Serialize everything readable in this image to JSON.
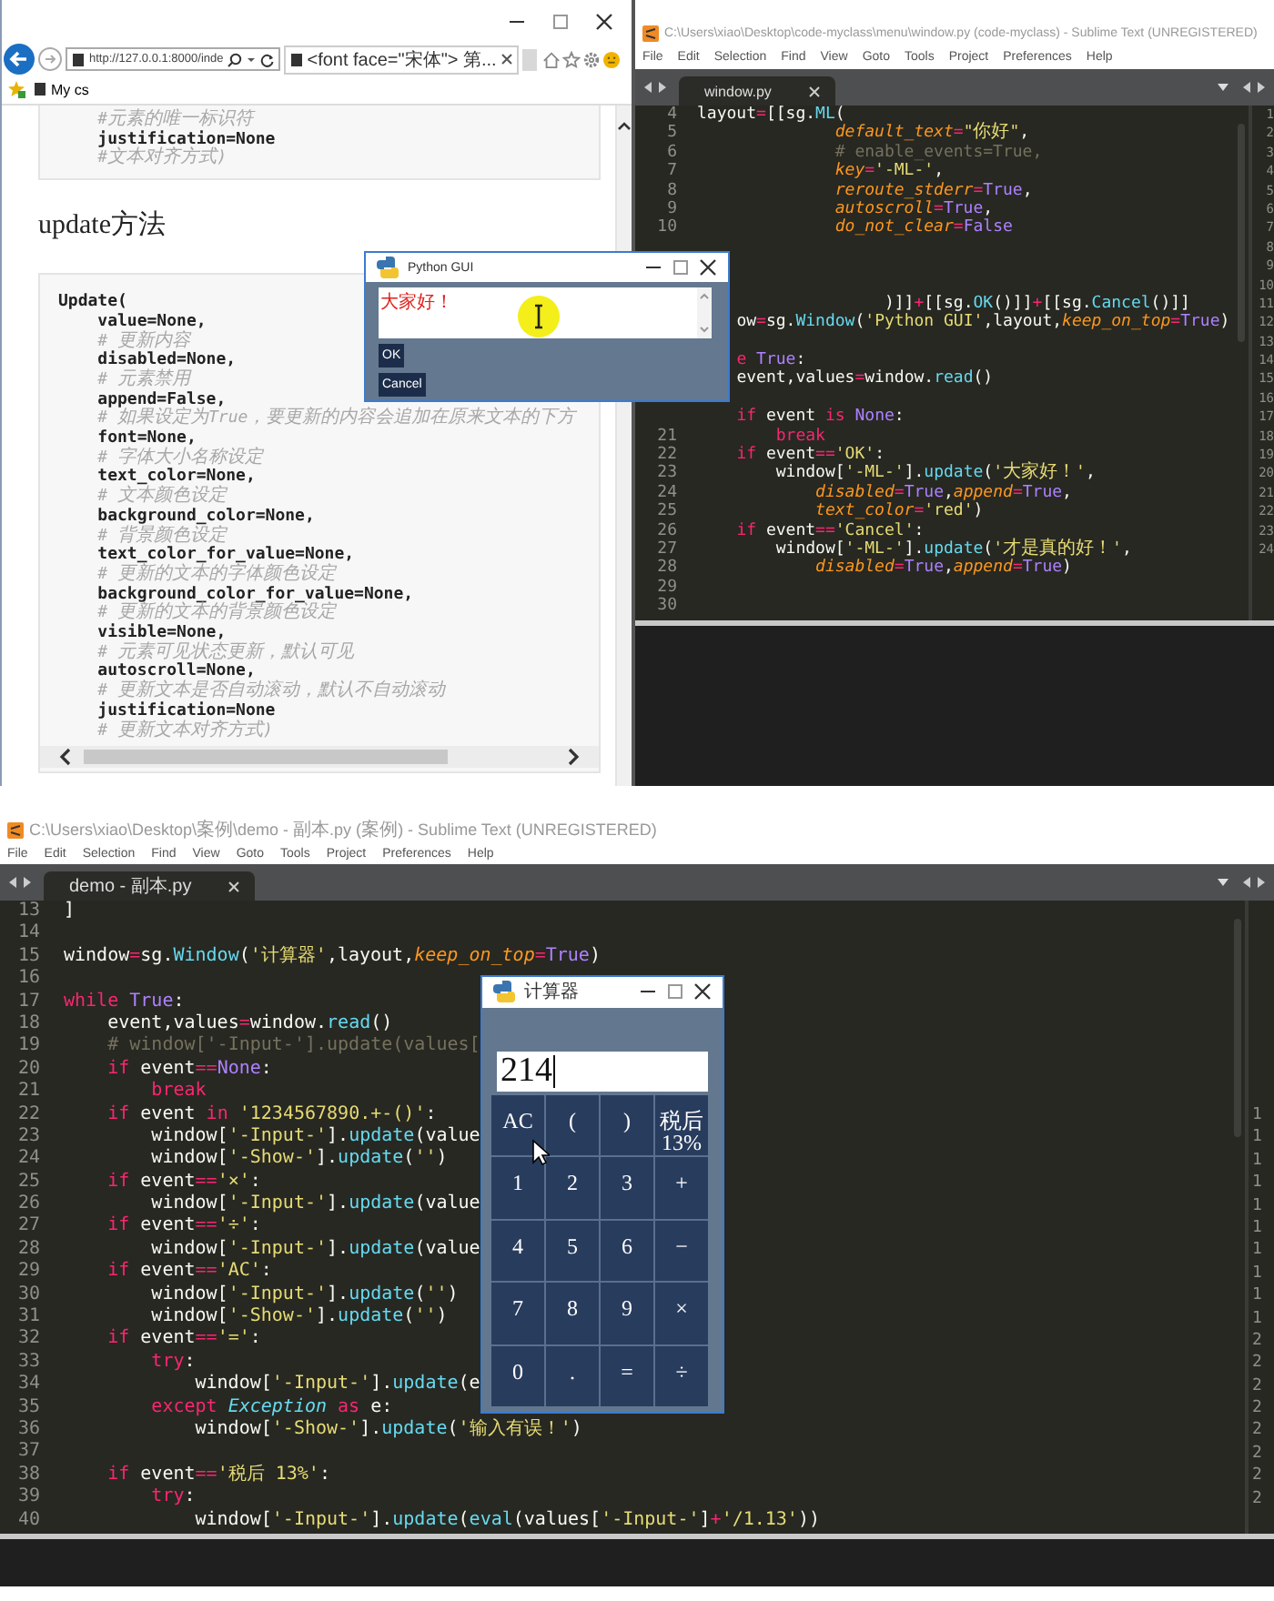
{
  "browser": {
    "address": "http://127.0.0.1:8000/inde",
    "tab": {
      "title": "<font face=\"宋体\"> 第..."
    },
    "favorites": [
      {
        "label": "My cs"
      }
    ],
    "page": {
      "code_block_1": [
        {
          "kind": "comment",
          "text": "    #元素的唯一标识符"
        },
        {
          "kind": "code",
          "text": "    justification=None"
        },
        {
          "kind": "comment",
          "text": "    #文本对齐方式)"
        }
      ],
      "heading": "update方法",
      "code_block_2": [
        {
          "kind": "code",
          "text": "Update("
        },
        {
          "kind": "code",
          "text": "    value=None,"
        },
        {
          "kind": "comment",
          "text": "    # 更新内容"
        },
        {
          "kind": "code",
          "text": "    disabled=None,"
        },
        {
          "kind": "comment",
          "text": "    # 元素禁用"
        },
        {
          "kind": "code",
          "text": "    append=False,"
        },
        {
          "kind": "comment",
          "text": "    # 如果设定为True，要更新的内容会追加在原来文本的下方"
        },
        {
          "kind": "code",
          "text": "    font=None,"
        },
        {
          "kind": "comment",
          "text": "    # 字体大小名称设定"
        },
        {
          "kind": "code",
          "text": "    text_color=None,"
        },
        {
          "kind": "comment",
          "text": "    # 文本颜色设定"
        },
        {
          "kind": "code",
          "text": "    background_color=None,"
        },
        {
          "kind": "comment",
          "text": "    # 背景颜色设定"
        },
        {
          "kind": "code",
          "text": "    text_color_for_value=None,"
        },
        {
          "kind": "comment",
          "text": "    # 更新的文本的字体颜色设定"
        },
        {
          "kind": "code",
          "text": "    background_color_for_value=None,"
        },
        {
          "kind": "comment",
          "text": "    # 更新的文本的背景颜色设定"
        },
        {
          "kind": "code",
          "text": "    visible=None,"
        },
        {
          "kind": "comment",
          "text": "    # 元素可见状态更新，默认可见"
        },
        {
          "kind": "code",
          "text": "    autoscroll=None,"
        },
        {
          "kind": "comment",
          "text": "    # 更新文本是否自动滚动，默认不自动滚动"
        },
        {
          "kind": "code",
          "text": "    justification=None"
        },
        {
          "kind": "comment",
          "text": "    # 更新文本对齐方式)"
        }
      ]
    }
  },
  "python_gui": {
    "title": "Python GUI",
    "output": "大家好！",
    "buttons": [
      "OK",
      "Cancel"
    ]
  },
  "editor_top": {
    "title": "C:\\Users\\xiao\\Desktop\\code-myclass\\menu\\window.py (code-myclass) - Sublime Text (UNREGISTERED)",
    "menu": [
      "File",
      "Edit",
      "Selection",
      "Find",
      "View",
      "Goto",
      "Tools",
      "Project",
      "Preferences",
      "Help"
    ],
    "tab": "window.py",
    "lines": [
      {
        "kind": "code",
        "number": "4",
        "code": [
          {
            "kind": "plain",
            "text": "layout"
          },
          {
            "kind": "op",
            "text": "="
          },
          {
            "kind": "plain",
            "text": "[[sg."
          },
          {
            "kind": "func",
            "text": "ML"
          },
          {
            "kind": "plain",
            "text": "("
          }
        ]
      },
      {
        "kind": "code",
        "number": "5",
        "code": [
          {
            "kind": "param",
            "text": "              default_text"
          },
          {
            "kind": "op",
            "text": "="
          },
          {
            "kind": "string",
            "text": "\"你好\""
          },
          {
            "kind": "plain",
            "text": ","
          }
        ]
      },
      {
        "kind": "code",
        "number": "6",
        "code": [
          {
            "kind": "comment",
            "text": "              # enable_events=True,"
          }
        ]
      },
      {
        "kind": "code",
        "number": "7",
        "code": [
          {
            "kind": "param",
            "text": "              key"
          },
          {
            "kind": "op",
            "text": "="
          },
          {
            "kind": "string",
            "text": "'-ML-'"
          },
          {
            "kind": "plain",
            "text": ","
          }
        ]
      },
      {
        "kind": "code",
        "number": "8",
        "code": [
          {
            "kind": "param",
            "text": "              reroute_stderr"
          },
          {
            "kind": "op",
            "text": "="
          },
          {
            "kind": "const",
            "text": "True"
          },
          {
            "kind": "plain",
            "text": ","
          }
        ]
      },
      {
        "kind": "code",
        "number": "9",
        "code": [
          {
            "kind": "param",
            "text": "              autoscroll"
          },
          {
            "kind": "op",
            "text": "="
          },
          {
            "kind": "const",
            "text": "True"
          },
          {
            "kind": "plain",
            "text": ","
          }
        ]
      },
      {
        "kind": "code",
        "number": "10",
        "code": [
          {
            "kind": "param",
            "text": "              do_not_clear"
          },
          {
            "kind": "op",
            "text": "="
          },
          {
            "kind": "const",
            "text": "False"
          }
        ]
      },
      {
        "kind": "blank"
      },
      {
        "kind": "blank"
      },
      {
        "kind": "blank"
      },
      {
        "kind": "code",
        "code": [
          {
            "kind": "plain",
            "text": "                   )]]"
          },
          {
            "kind": "op",
            "text": "+"
          },
          {
            "kind": "plain",
            "text": "[[sg."
          },
          {
            "kind": "func",
            "text": "OK"
          },
          {
            "kind": "plain",
            "text": "()]]"
          },
          {
            "kind": "op",
            "text": "+"
          },
          {
            "kind": "plain",
            "text": "[[sg."
          },
          {
            "kind": "func",
            "text": "Cancel"
          },
          {
            "kind": "plain",
            "text": "()]]"
          }
        ]
      },
      {
        "kind": "code",
        "code": [
          {
            "kind": "plain",
            "text": "    ow"
          },
          {
            "kind": "op",
            "text": "="
          },
          {
            "kind": "plain",
            "text": "sg."
          },
          {
            "kind": "func",
            "text": "Window"
          },
          {
            "kind": "plain",
            "text": "("
          },
          {
            "kind": "string",
            "text": "'Python GUI'"
          },
          {
            "kind": "plain",
            "text": ",layout,"
          },
          {
            "kind": "param",
            "text": "keep_on_top"
          },
          {
            "kind": "op",
            "text": "="
          },
          {
            "kind": "const",
            "text": "True"
          },
          {
            "kind": "plain",
            "text": ")"
          }
        ]
      },
      {
        "kind": "blank"
      },
      {
        "kind": "code",
        "code": [
          {
            "kind": "keyword",
            "text": "    e"
          },
          {
            "kind": "const",
            "text": " True"
          },
          {
            "kind": "plain",
            "text": ":"
          }
        ]
      },
      {
        "kind": "code",
        "code": [
          {
            "kind": "plain",
            "text": "    event,values"
          },
          {
            "kind": "op",
            "text": "="
          },
          {
            "kind": "plain",
            "text": "window."
          },
          {
            "kind": "func",
            "text": "read"
          },
          {
            "kind": "plain",
            "text": "()"
          }
        ]
      },
      {
        "kind": "blank"
      },
      {
        "kind": "code",
        "code": [
          {
            "kind": "keyword",
            "text": "    if"
          },
          {
            "kind": "plain",
            "text": " event "
          },
          {
            "kind": "keyword",
            "text": "is"
          },
          {
            "kind": "const",
            "text": " None"
          },
          {
            "kind": "plain",
            "text": ":"
          }
        ]
      },
      {
        "kind": "code",
        "number": "21",
        "code": [
          {
            "kind": "keyword",
            "text": "        break"
          }
        ]
      },
      {
        "kind": "code",
        "number": "22",
        "code": [
          {
            "kind": "keyword",
            "text": "    if"
          },
          {
            "kind": "plain",
            "text": " event"
          },
          {
            "kind": "op",
            "text": "=="
          },
          {
            "kind": "string",
            "text": "'OK'"
          },
          {
            "kind": "plain",
            "text": ":"
          }
        ]
      },
      {
        "kind": "code",
        "number": "23",
        "code": [
          {
            "kind": "plain",
            "text": "        window["
          },
          {
            "kind": "string",
            "text": "'-ML-'"
          },
          {
            "kind": "plain",
            "text": "]."
          },
          {
            "kind": "func",
            "text": "update"
          },
          {
            "kind": "plain",
            "text": "("
          },
          {
            "kind": "string",
            "text": "'大家好！'"
          },
          {
            "kind": "plain",
            "text": ","
          }
        ]
      },
      {
        "kind": "code",
        "number": "24",
        "code": [
          {
            "kind": "param",
            "text": "            disabled"
          },
          {
            "kind": "op",
            "text": "="
          },
          {
            "kind": "const",
            "text": "True"
          },
          {
            "kind": "plain",
            "text": ","
          },
          {
            "kind": "param",
            "text": "append"
          },
          {
            "kind": "op",
            "text": "="
          },
          {
            "kind": "const",
            "text": "True"
          },
          {
            "kind": "plain",
            "text": ","
          }
        ]
      },
      {
        "kind": "code",
        "number": "25",
        "code": [
          {
            "kind": "param",
            "text": "            text_color"
          },
          {
            "kind": "op",
            "text": "="
          },
          {
            "kind": "string",
            "text": "'red'"
          },
          {
            "kind": "plain",
            "text": ")"
          }
        ]
      },
      {
        "kind": "code",
        "number": "26",
        "code": [
          {
            "kind": "keyword",
            "text": "    if"
          },
          {
            "kind": "plain",
            "text": " event"
          },
          {
            "kind": "op",
            "text": "=="
          },
          {
            "kind": "string",
            "text": "'Cancel'"
          },
          {
            "kind": "plain",
            "text": ":"
          }
        ]
      },
      {
        "kind": "code",
        "number": "27",
        "code": [
          {
            "kind": "plain",
            "text": "        window["
          },
          {
            "kind": "string",
            "text": "'-ML-'"
          },
          {
            "kind": "plain",
            "text": "]."
          },
          {
            "kind": "func",
            "text": "update"
          },
          {
            "kind": "plain",
            "text": "("
          },
          {
            "kind": "string",
            "text": "'才是真的好！'"
          },
          {
            "kind": "plain",
            "text": ","
          }
        ]
      },
      {
        "kind": "code",
        "number": "28",
        "code": [
          {
            "kind": "param",
            "text": "            disabled"
          },
          {
            "kind": "op",
            "text": "="
          },
          {
            "kind": "const",
            "text": "True"
          },
          {
            "kind": "plain",
            "text": ","
          },
          {
            "kind": "param",
            "text": "append"
          },
          {
            "kind": "op",
            "text": "="
          },
          {
            "kind": "const",
            "text": "True"
          },
          {
            "kind": "plain",
            "text": ")"
          }
        ]
      },
      {
        "kind": "code",
        "number": "29"
      },
      {
        "kind": "code",
        "number": "30"
      }
    ],
    "side_numbers": [
      "1",
      "2",
      "3",
      "4",
      "5",
      "6",
      "7",
      "8",
      "9",
      "10",
      "11",
      "12",
      "13",
      "14",
      "15",
      "16",
      "17",
      "18",
      "19",
      "20",
      "21",
      "22",
      "23",
      "24"
    ]
  },
  "editor_bottom": {
    "title": "C:\\Users\\xiao\\Desktop\\案例\\demo - 副本.py (案例) - Sublime Text (UNREGISTERED)",
    "menu": [
      "File",
      "Edit",
      "Selection",
      "Find",
      "View",
      "Goto",
      "Tools",
      "Project",
      "Preferences",
      "Help"
    ],
    "tab": "demo - 副本.py",
    "lines": [
      {
        "kind": "code",
        "number": "13",
        "code": [
          {
            "kind": "plain",
            "text": "]"
          }
        ]
      },
      {
        "kind": "code",
        "number": "14"
      },
      {
        "kind": "code",
        "number": "15",
        "code": [
          {
            "kind": "plain",
            "text": "window"
          },
          {
            "kind": "op",
            "text": "="
          },
          {
            "kind": "plain",
            "text": "sg."
          },
          {
            "kind": "func",
            "text": "Window"
          },
          {
            "kind": "plain",
            "text": "("
          },
          {
            "kind": "string",
            "text": "'计算器'"
          },
          {
            "kind": "plain",
            "text": ",layout,"
          },
          {
            "kind": "param",
            "text": "keep_on_top"
          },
          {
            "kind": "op",
            "text": "="
          },
          {
            "kind": "const",
            "text": "True"
          },
          {
            "kind": "plain",
            "text": ")"
          }
        ]
      },
      {
        "kind": "code",
        "number": "16"
      },
      {
        "kind": "code",
        "number": "17",
        "code": [
          {
            "kind": "keyword",
            "text": "while"
          },
          {
            "kind": "const",
            "text": " True"
          },
          {
            "kind": "plain",
            "text": ":"
          }
        ]
      },
      {
        "kind": "code",
        "number": "18",
        "code": [
          {
            "kind": "plain",
            "text": "    event,values"
          },
          {
            "kind": "op",
            "text": "="
          },
          {
            "kind": "plain",
            "text": "window."
          },
          {
            "kind": "func",
            "text": "read"
          },
          {
            "kind": "plain",
            "text": "()"
          }
        ]
      },
      {
        "kind": "code",
        "number": "19",
        "code": [
          {
            "kind": "comment",
            "text": "    # window['-Input-'].update(values["
          }
        ]
      },
      {
        "kind": "code",
        "number": "20",
        "code": [
          {
            "kind": "keyword",
            "text": "    if"
          },
          {
            "kind": "plain",
            "text": " event"
          },
          {
            "kind": "op",
            "text": "=="
          },
          {
            "kind": "const",
            "text": "None"
          },
          {
            "kind": "plain",
            "text": ":"
          }
        ]
      },
      {
        "kind": "code",
        "number": "21",
        "code": [
          {
            "kind": "keyword",
            "text": "        break"
          }
        ]
      },
      {
        "kind": "code",
        "number": "22",
        "code": [
          {
            "kind": "keyword",
            "text": "    if"
          },
          {
            "kind": "plain",
            "text": " event "
          },
          {
            "kind": "keyword",
            "text": "in"
          },
          {
            "kind": "string",
            "text": " '1234567890.+-()'"
          },
          {
            "kind": "plain",
            "text": ":"
          }
        ]
      },
      {
        "kind": "code",
        "number": "23",
        "code": [
          {
            "kind": "plain",
            "text": "        window["
          },
          {
            "kind": "string",
            "text": "'-Input-'"
          },
          {
            "kind": "plain",
            "text": "]."
          },
          {
            "kind": "func",
            "text": "update"
          },
          {
            "kind": "plain",
            "text": "(value"
          }
        ]
      },
      {
        "kind": "code",
        "number": "24",
        "code": [
          {
            "kind": "plain",
            "text": "        window["
          },
          {
            "kind": "string",
            "text": "'-Show-'"
          },
          {
            "kind": "plain",
            "text": "]."
          },
          {
            "kind": "func",
            "text": "update"
          },
          {
            "kind": "plain",
            "text": "("
          },
          {
            "kind": "string",
            "text": "''"
          },
          {
            "kind": "plain",
            "text": ")"
          }
        ]
      },
      {
        "kind": "code",
        "number": "25",
        "code": [
          {
            "kind": "keyword",
            "text": "    if"
          },
          {
            "kind": "plain",
            "text": " event"
          },
          {
            "kind": "op",
            "text": "=="
          },
          {
            "kind": "string",
            "text": "'×'"
          },
          {
            "kind": "plain",
            "text": ":"
          }
        ]
      },
      {
        "kind": "code",
        "number": "26",
        "code": [
          {
            "kind": "plain",
            "text": "        window["
          },
          {
            "kind": "string",
            "text": "'-Input-'"
          },
          {
            "kind": "plain",
            "text": "]."
          },
          {
            "kind": "func",
            "text": "update"
          },
          {
            "kind": "plain",
            "text": "(value"
          }
        ]
      },
      {
        "kind": "code",
        "number": "27",
        "code": [
          {
            "kind": "keyword",
            "text": "    if"
          },
          {
            "kind": "plain",
            "text": " event"
          },
          {
            "kind": "op",
            "text": "=="
          },
          {
            "kind": "string",
            "text": "'÷'"
          },
          {
            "kind": "plain",
            "text": ":"
          }
        ]
      },
      {
        "kind": "code",
        "number": "28",
        "code": [
          {
            "kind": "plain",
            "text": "        window["
          },
          {
            "kind": "string",
            "text": "'-Input-'"
          },
          {
            "kind": "plain",
            "text": "]."
          },
          {
            "kind": "func",
            "text": "update"
          },
          {
            "kind": "plain",
            "text": "(value"
          }
        ]
      },
      {
        "kind": "code",
        "number": "29",
        "code": [
          {
            "kind": "keyword",
            "text": "    if"
          },
          {
            "kind": "plain",
            "text": " event"
          },
          {
            "kind": "op",
            "text": "=="
          },
          {
            "kind": "string",
            "text": "'AC'"
          },
          {
            "kind": "plain",
            "text": ":"
          }
        ]
      },
      {
        "kind": "code",
        "number": "30",
        "code": [
          {
            "kind": "plain",
            "text": "        window["
          },
          {
            "kind": "string",
            "text": "'-Input-'"
          },
          {
            "kind": "plain",
            "text": "]."
          },
          {
            "kind": "func",
            "text": "update"
          },
          {
            "kind": "plain",
            "text": "("
          },
          {
            "kind": "string",
            "text": "''"
          },
          {
            "kind": "plain",
            "text": ")"
          }
        ]
      },
      {
        "kind": "code",
        "number": "31",
        "code": [
          {
            "kind": "plain",
            "text": "        window["
          },
          {
            "kind": "string",
            "text": "'-Show-'"
          },
          {
            "kind": "plain",
            "text": "]."
          },
          {
            "kind": "func",
            "text": "update"
          },
          {
            "kind": "plain",
            "text": "("
          },
          {
            "kind": "string",
            "text": "''"
          },
          {
            "kind": "plain",
            "text": ")"
          }
        ]
      },
      {
        "kind": "code",
        "number": "32",
        "code": [
          {
            "kind": "keyword",
            "text": "    if"
          },
          {
            "kind": "plain",
            "text": " event"
          },
          {
            "kind": "op",
            "text": "=="
          },
          {
            "kind": "string",
            "text": "'='"
          },
          {
            "kind": "plain",
            "text": ":"
          }
        ]
      },
      {
        "kind": "code",
        "number": "33",
        "code": [
          {
            "kind": "keyword",
            "text": "        try"
          },
          {
            "kind": "plain",
            "text": ":"
          }
        ]
      },
      {
        "kind": "code",
        "number": "34",
        "code": [
          {
            "kind": "plain",
            "text": "            window["
          },
          {
            "kind": "string",
            "text": "'-Input-'"
          },
          {
            "kind": "plain",
            "text": "]."
          },
          {
            "kind": "func",
            "text": "update"
          },
          {
            "kind": "plain",
            "text": "(e"
          }
        ]
      },
      {
        "kind": "code",
        "number": "35",
        "code": [
          {
            "kind": "keyword",
            "text": "        except"
          },
          {
            "kind": "type",
            "text": " Exception"
          },
          {
            "kind": "keyword",
            "text": " as"
          },
          {
            "kind": "plain",
            "text": " e:"
          }
        ]
      },
      {
        "kind": "code",
        "number": "36",
        "code": [
          {
            "kind": "plain",
            "text": "            window["
          },
          {
            "kind": "string",
            "text": "'-Show-'"
          },
          {
            "kind": "plain",
            "text": "]."
          },
          {
            "kind": "func",
            "text": "update"
          },
          {
            "kind": "plain",
            "text": "("
          },
          {
            "kind": "string",
            "text": "'输入有误！'"
          },
          {
            "kind": "plain",
            "text": ")"
          }
        ]
      },
      {
        "kind": "code",
        "number": "37"
      },
      {
        "kind": "code",
        "number": "38",
        "code": [
          {
            "kind": "keyword",
            "text": "    if"
          },
          {
            "kind": "plain",
            "text": " event"
          },
          {
            "kind": "op",
            "text": "=="
          },
          {
            "kind": "string",
            "text": "'税后 13%'"
          },
          {
            "kind": "plain",
            "text": ":"
          }
        ]
      },
      {
        "kind": "code",
        "number": "39",
        "code": [
          {
            "kind": "keyword",
            "text": "        try"
          },
          {
            "kind": "plain",
            "text": ":"
          }
        ]
      },
      {
        "kind": "code",
        "number": "40",
        "code": [
          {
            "kind": "plain",
            "text": "            window["
          },
          {
            "kind": "string",
            "text": "'-Input-'"
          },
          {
            "kind": "plain",
            "text": "]."
          },
          {
            "kind": "func",
            "text": "update"
          },
          {
            "kind": "plain",
            "text": "("
          },
          {
            "kind": "func",
            "text": "eval"
          },
          {
            "kind": "plain",
            "text": "(values["
          },
          {
            "kind": "string",
            "text": "'-Input-'"
          },
          {
            "kind": "plain",
            "text": "]"
          },
          {
            "kind": "op",
            "text": "+"
          },
          {
            "kind": "string",
            "text": "'/1.13'"
          },
          {
            "kind": "plain",
            "text": "))"
          }
        ]
      }
    ],
    "side_numbers": [
      "1",
      "1",
      "1",
      "1",
      "1",
      "1",
      "1",
      "1",
      "1",
      "1",
      "2",
      "2",
      "2",
      "2",
      "2",
      "2",
      "2",
      "2"
    ]
  },
  "calculator": {
    "title": "计算器",
    "display": "214",
    "keys": [
      "AC",
      "(",
      ")",
      "税后 13%",
      "1",
      "2",
      "3",
      "+",
      "4",
      "5",
      "6",
      "−",
      "7",
      "8",
      "9",
      "×",
      "0",
      ".",
      "=",
      "÷"
    ]
  }
}
